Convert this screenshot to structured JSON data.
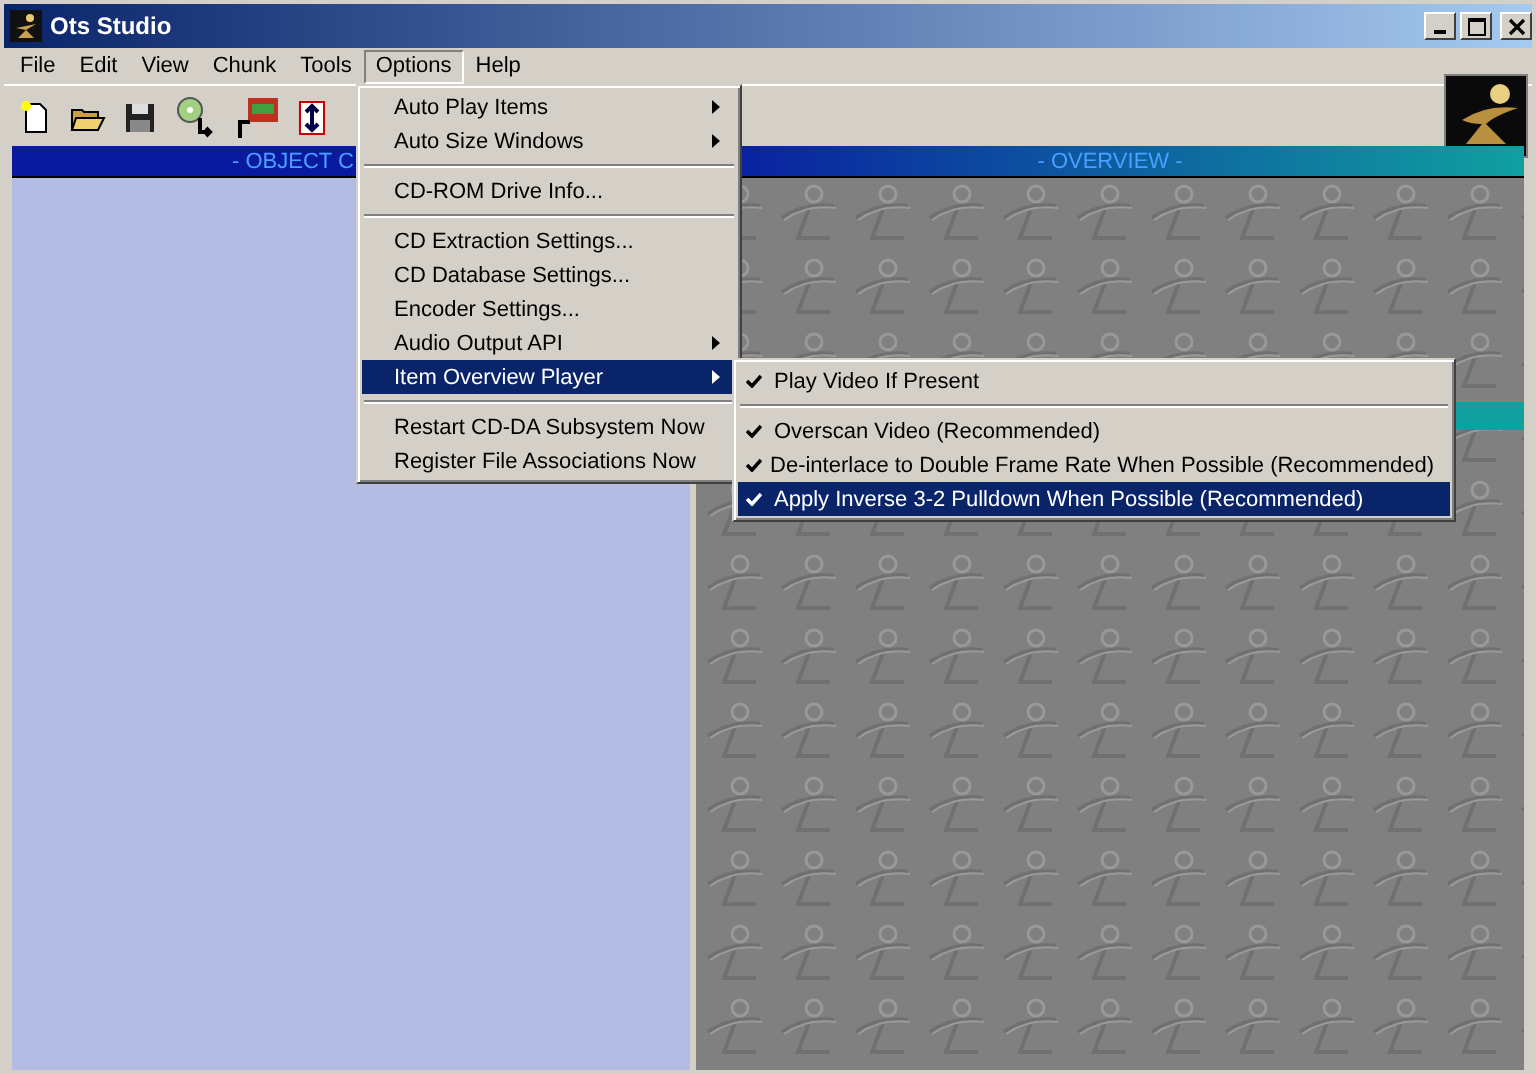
{
  "window": {
    "title": "Ots Studio"
  },
  "menu_bar": [
    {
      "label": "File",
      "selected": false
    },
    {
      "label": "Edit",
      "selected": false
    },
    {
      "label": "View",
      "selected": false
    },
    {
      "label": "Chunk",
      "selected": false
    },
    {
      "label": "Tools",
      "selected": false
    },
    {
      "label": "Options",
      "selected": true
    },
    {
      "label": "Help",
      "selected": false
    }
  ],
  "panels": {
    "left_title": "- OBJECT C",
    "right_title": "- OVERVIEW -"
  },
  "options_menu": [
    {
      "kind": "item",
      "label": "Auto Play Items",
      "submenu": true,
      "selected": false
    },
    {
      "kind": "item",
      "label": "Auto Size Windows",
      "submenu": true,
      "selected": false
    },
    {
      "kind": "separator"
    },
    {
      "kind": "item",
      "label": "CD-ROM Drive Info...",
      "submenu": false,
      "selected": false
    },
    {
      "kind": "separator"
    },
    {
      "kind": "item",
      "label": "CD Extraction Settings...",
      "submenu": false,
      "selected": false
    },
    {
      "kind": "item",
      "label": "CD Database Settings...",
      "submenu": false,
      "selected": false
    },
    {
      "kind": "item",
      "label": "Encoder Settings...",
      "submenu": false,
      "selected": false
    },
    {
      "kind": "item",
      "label": "Audio Output API",
      "submenu": true,
      "selected": false
    },
    {
      "kind": "item",
      "label": "Item Overview Player",
      "submenu": true,
      "selected": true
    },
    {
      "kind": "separator"
    },
    {
      "kind": "item",
      "label": "Restart CD-DA Subsystem Now",
      "submenu": false,
      "selected": false
    },
    {
      "kind": "item",
      "label": "Register File Associations Now",
      "submenu": false,
      "selected": false
    }
  ],
  "player_submenu": [
    {
      "kind": "item",
      "label": "Play Video If Present",
      "checked": true,
      "selected": false
    },
    {
      "kind": "separator"
    },
    {
      "kind": "item",
      "label": "Overscan Video (Recommended)",
      "checked": true,
      "selected": false
    },
    {
      "kind": "item",
      "label": "De-interlace to Double Frame Rate When Possible (Recommended)",
      "checked": true,
      "selected": false
    },
    {
      "kind": "item",
      "label": "Apply Inverse 3-2 Pulldown When Possible (Recommended)",
      "checked": true,
      "selected": true
    }
  ]
}
